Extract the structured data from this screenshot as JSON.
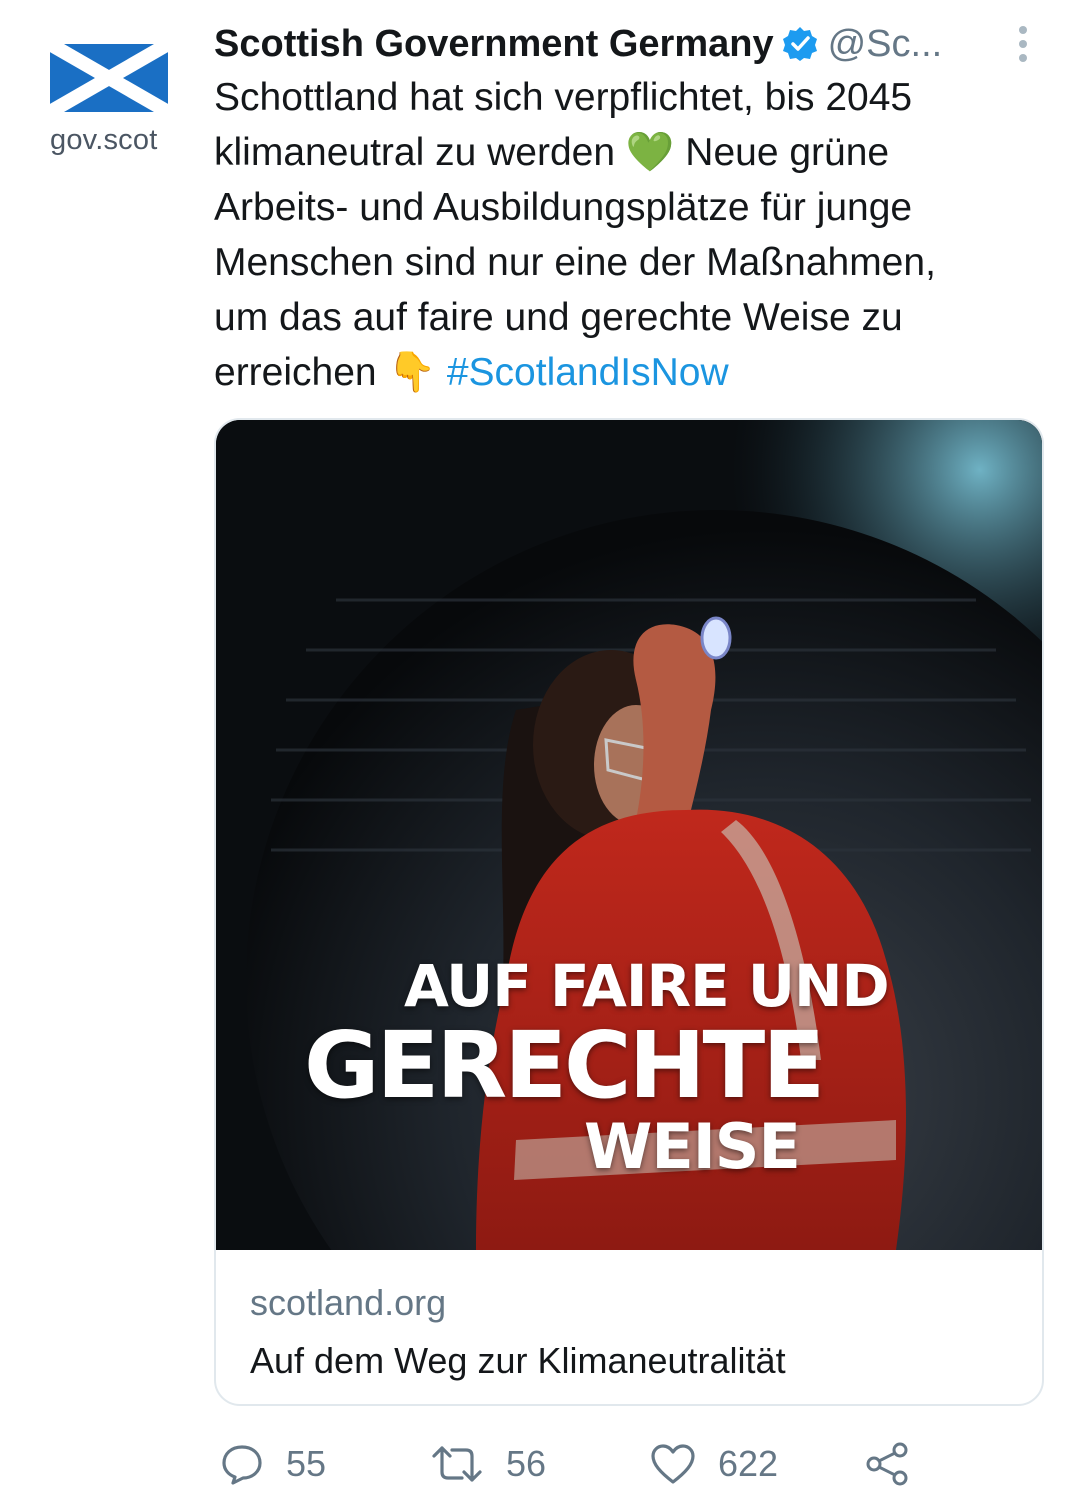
{
  "avatar": {
    "icon": "saltire-flag",
    "label": "gov.scot",
    "flag_color": "#1a6fc4"
  },
  "header": {
    "display_name": "Scottish Government Germany",
    "verified": true,
    "handle": "@Sc...",
    "more_icon": "vertical-dots-icon"
  },
  "tweet": {
    "line1": "Schottland hat sich verpflichtet, bis 2045",
    "line2_before": "klimaneutral zu werden ",
    "heart_emoji": "💚",
    "line2_after": " Neue grüne",
    "line3": "Arbeits- und Ausbildungsplätze für junge",
    "line4": "Menschen sind nur eine der Maßnahmen,",
    "line5": "um das auf faire und gerechte Weise zu",
    "line6_before": "erreichen ",
    "point_emoji": "👇",
    "hashtag": "#ScotlandIsNow"
  },
  "card": {
    "overlay_line1": "AUF FAIRE UND",
    "overlay_line2": "GERECHTE",
    "overlay_line3": "WEISE",
    "domain": "scotland.org",
    "title": "Auf dem Weg zur Klimaneutralität"
  },
  "actions": {
    "replies": "55",
    "retweets": "56",
    "likes": "622",
    "share_icon": "share-icon"
  },
  "colors": {
    "accent": "#1b95e0",
    "muted": "#657786",
    "text": "#14171a"
  }
}
